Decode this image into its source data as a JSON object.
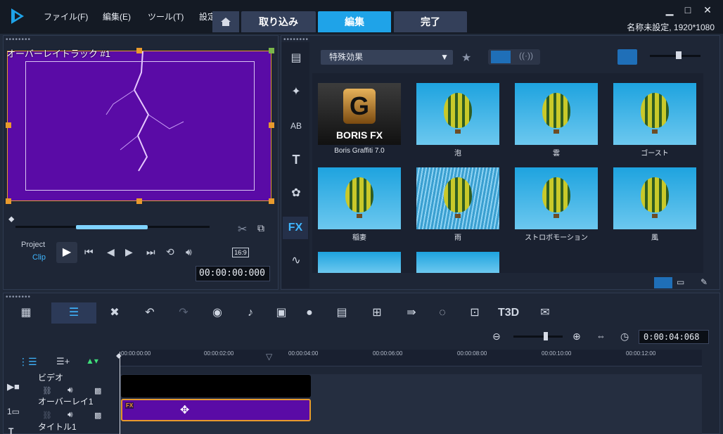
{
  "titlebar": {
    "menus": [
      "ファイル(F)",
      "編集(E)",
      "ツール(T)",
      "設定"
    ],
    "tabs": {
      "import": "取り込み",
      "edit": "編集",
      "finish": "完了"
    },
    "project_info": "名称未設定, 1920*1080"
  },
  "preview": {
    "overlay_label": "オーバーレイトラック #1",
    "project_label": "Project",
    "clip_label": "Clip",
    "aspect": "16:9",
    "timecode": "00:00:00:000"
  },
  "library": {
    "category": "特殊効果",
    "items": [
      {
        "label": "Boris Graffiti 7.0",
        "logo_text": "BORIS FX"
      },
      {
        "label": "泡"
      },
      {
        "label": "雲"
      },
      {
        "label": "ゴースト"
      },
      {
        "label": "稲妻"
      },
      {
        "label": "雨"
      },
      {
        "label": "ストロボモーション"
      },
      {
        "label": "風"
      }
    ]
  },
  "timeline": {
    "timecode": "0:00:04:068",
    "ruler": [
      "00:00:00:00",
      "00:00:02:00",
      "00:00:04:00",
      "00:00:06:00",
      "00:00:08:00",
      "00:00:10:00",
      "00:00:12:00"
    ],
    "tracks": {
      "video": "ビデオ",
      "overlay": "オーバーレイ1",
      "title": "タイトル1"
    },
    "clip_fx": "FX"
  },
  "colors": {
    "accent": "#1fa3e8",
    "overlay_purple": "#5a0ba6",
    "handle_orange": "#e89a2d"
  }
}
